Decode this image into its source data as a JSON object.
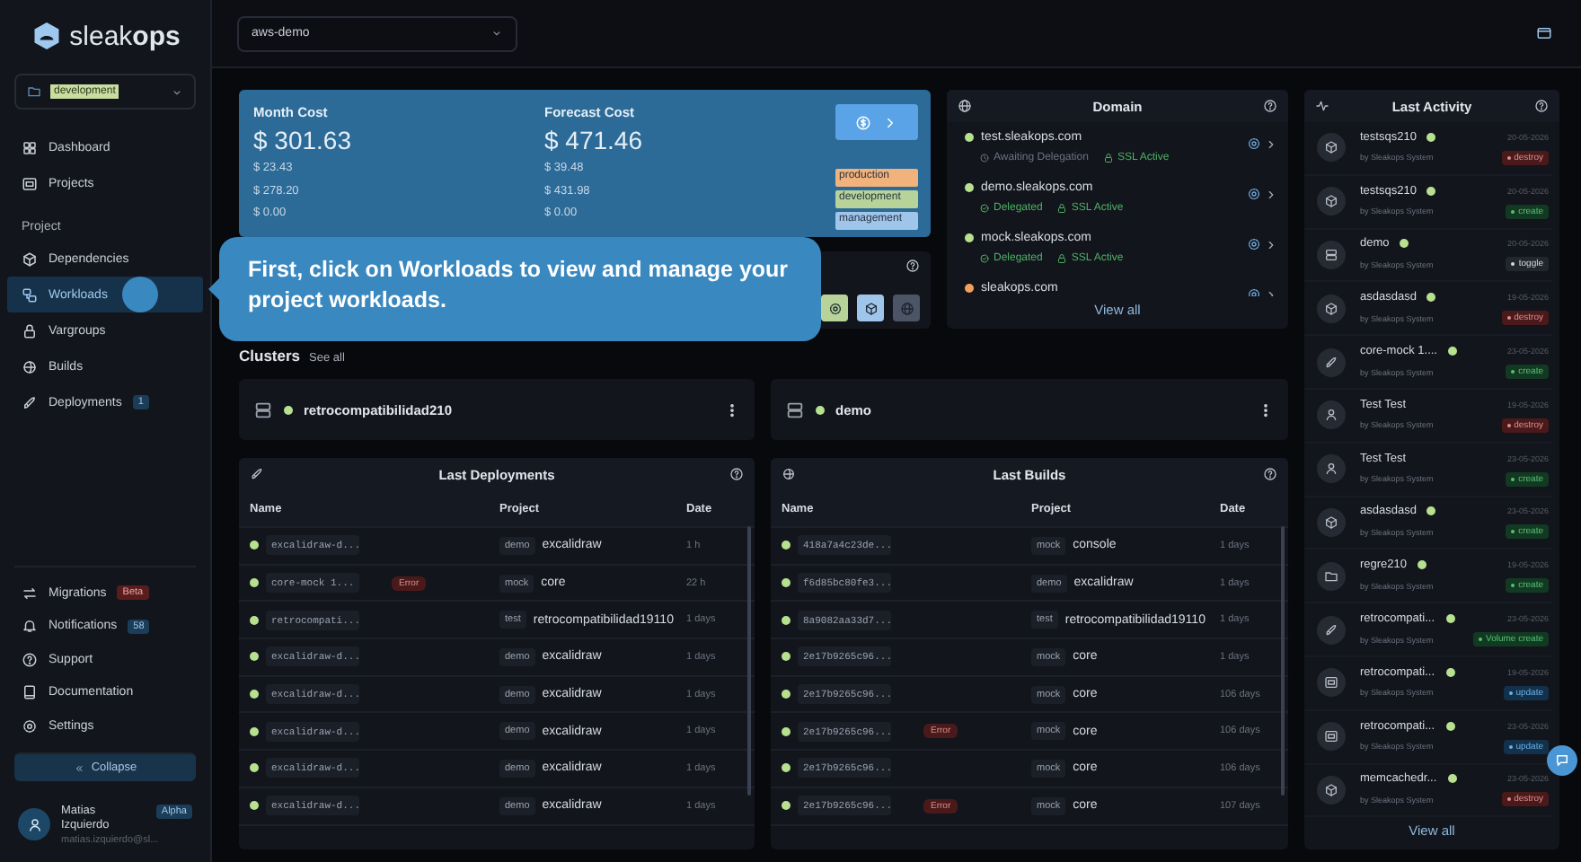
{
  "sidebar": {
    "logo": "sleak**ops**",
    "environment": "development",
    "nav": [
      {
        "label": "Dashboard",
        "selected": false
      },
      {
        "label": "Projects",
        "selected": false
      }
    ],
    "section": "Project",
    "project_nav": [
      {
        "label": "Dependencies",
        "selected": false
      },
      {
        "label": "Workloads",
        "selected": true
      },
      {
        "label": "Vargroups",
        "selected": false
      },
      {
        "label": "Builds",
        "selected": false
      },
      {
        "label": "Deployments",
        "selected": false,
        "badge": {
          "text": "1",
          "kind": "count"
        }
      }
    ],
    "bottom_nav": [
      {
        "label": "Migrations",
        "badge": {
          "text": "Beta",
          "kind": "beta"
        }
      },
      {
        "label": "Notifications",
        "badge": {
          "text": "58",
          "kind": "count"
        }
      },
      {
        "label": "Support"
      },
      {
        "label": "Documentation"
      },
      {
        "label": "Settings"
      }
    ],
    "collapse": "Collapse",
    "user": {
      "name": "Matias Izquierdo",
      "plan": "Alpha",
      "email": "matias.izquierdo@sl..."
    }
  },
  "topbar": {
    "account": "aws-demo"
  },
  "tour": {
    "text": "First, click on Workloads to view and manage your project workloads."
  },
  "costs": {
    "columns": [
      {
        "title": "Month Cost",
        "total": "$ 301.63",
        "lines": [
          "$ 23.43",
          "$ 278.20",
          "$ 0.00"
        ]
      },
      {
        "title": "Forecast Cost",
        "total": "$ 471.46",
        "lines": [
          "$ 39.48",
          "$ 431.98",
          "$ 0.00"
        ]
      }
    ],
    "environments": [
      {
        "label": "production",
        "color": "#f2b27c"
      },
      {
        "label": "development",
        "color": "#b7d39a"
      },
      {
        "label": "management",
        "color": "#9fc6ea"
      }
    ]
  },
  "toolbar_buttons": [
    {
      "color": "#b7d39a"
    },
    {
      "color": "#9fc6ea"
    },
    {
      "color": "#4b5566"
    }
  ],
  "domain": {
    "title": "Domain",
    "items": [
      {
        "name": "test.sleakops.com",
        "color": "#b7e08f",
        "delegation": {
          "text": "Awaiting Delegation",
          "kind": "pending"
        },
        "ssl": "SSL Active"
      },
      {
        "name": "demo.sleakops.com",
        "color": "#b7e08f",
        "delegation": {
          "text": "Delegated",
          "kind": "done"
        },
        "ssl": "SSL Active"
      },
      {
        "name": "mock.sleakops.com",
        "color": "#b7e08f",
        "delegation": {
          "text": "Delegated",
          "kind": "done"
        },
        "ssl": "SSL Active"
      },
      {
        "name": "sleakops.com",
        "color": "#f2a15c"
      }
    ],
    "view_all": "View all"
  },
  "clusters": {
    "title": "Clusters",
    "see_all": "See all",
    "items": [
      {
        "name": "retrocompatibilidad210"
      },
      {
        "name": "demo"
      }
    ]
  },
  "deployments": {
    "title": "Last Deployments",
    "columns": [
      "Name",
      "Project",
      "Date"
    ],
    "rows": [
      {
        "name": "excalidraw-d...",
        "env": "demo",
        "project": "excalidraw",
        "date": "1 h"
      },
      {
        "name": "core-mock 1...",
        "tag": "Error",
        "env": "mock",
        "project": "core",
        "date": "22 h"
      },
      {
        "name": "retrocompati...",
        "env": "test",
        "project": "retrocompatibilidad19110",
        "date": "1 days"
      },
      {
        "name": "excalidraw-d...",
        "env": "demo",
        "project": "excalidraw",
        "date": "1 days"
      },
      {
        "name": "excalidraw-d...",
        "env": "demo",
        "project": "excalidraw",
        "date": "1 days"
      },
      {
        "name": "excalidraw-d...",
        "env": "demo",
        "project": "excalidraw",
        "date": "1 days"
      },
      {
        "name": "excalidraw-d...",
        "env": "demo",
        "project": "excalidraw",
        "date": "1 days"
      },
      {
        "name": "excalidraw-d...",
        "env": "demo",
        "project": "excalidraw",
        "date": "1 days"
      }
    ]
  },
  "builds": {
    "title": "Last Builds",
    "columns": [
      "Name",
      "Project",
      "Date"
    ],
    "rows": [
      {
        "name": "418a7a4c23de...",
        "env": "mock",
        "project": "console",
        "date": "1 days"
      },
      {
        "name": "f6d85bc80fe3...",
        "env": "demo",
        "project": "excalidraw",
        "date": "1 days"
      },
      {
        "name": "8a9082aa33d7...",
        "env": "test",
        "project": "retrocompatibilidad19110",
        "date": "1 days"
      },
      {
        "name": "2e17b9265c96...",
        "env": "mock",
        "project": "core",
        "date": "1 days"
      },
      {
        "name": "2e17b9265c96...",
        "env": "mock",
        "project": "core",
        "date": "106 days"
      },
      {
        "name": "2e17b9265c96...",
        "tag": "Error",
        "env": "mock",
        "project": "core",
        "date": "106 days"
      },
      {
        "name": "2e17b9265c96...",
        "env": "mock",
        "project": "core",
        "date": "106 days"
      },
      {
        "name": "2e17b9265c96...",
        "tag": "Error",
        "env": "mock",
        "project": "core",
        "date": "107 days"
      }
    ]
  },
  "activity": {
    "title": "Last Activity",
    "items": [
      {
        "name": "testsqs210",
        "kind": "dependency",
        "online": true,
        "by": "by Sleakops System",
        "date": "20-05-2026",
        "action": {
          "text": "destroy",
          "kind": "destroy"
        }
      },
      {
        "name": "testsqs210",
        "kind": "dependency",
        "online": true,
        "by": "by Sleakops System",
        "date": "20-05-2026",
        "action": {
          "text": "create",
          "kind": "create"
        }
      },
      {
        "name": "demo",
        "kind": "cluster",
        "online": true,
        "by": "by Sleakops System",
        "date": "20-05-2026",
        "action": {
          "text": "toggle",
          "kind": "toggle"
        }
      },
      {
        "name": "asdasdasd",
        "kind": "dependency",
        "online": true,
        "by": "by Sleakops System",
        "date": "19-05-2026",
        "action": {
          "text": "destroy",
          "kind": "destroy"
        }
      },
      {
        "name": "core-mock 1....",
        "kind": "workload",
        "online": true,
        "by": "by Sleakops System",
        "date": "23-05-2026",
        "action": {
          "text": "create",
          "kind": "create"
        }
      },
      {
        "name": "Test Test",
        "kind": "user",
        "online": false,
        "by": "by Sleakops System",
        "date": "19-05-2026",
        "action": {
          "text": "destroy",
          "kind": "destroy"
        }
      },
      {
        "name": "Test Test",
        "kind": "user",
        "online": false,
        "by": "by Sleakops System",
        "date": "23-05-2026",
        "action": {
          "text": "create",
          "kind": "create"
        }
      },
      {
        "name": "asdasdasd",
        "kind": "dependency",
        "online": true,
        "by": "by Sleakops System",
        "date": "23-05-2026",
        "action": {
          "text": "create",
          "kind": "create"
        }
      },
      {
        "name": "regre210",
        "kind": "project",
        "online": true,
        "by": "by Sleakops System",
        "date": "19-05-2026",
        "action": {
          "text": "create",
          "kind": "create"
        }
      },
      {
        "name": "retrocompati...",
        "kind": "workload",
        "online": true,
        "by": "by Sleakops System",
        "date": "23-05-2026",
        "action": {
          "text": "Volume create",
          "kind": "create"
        }
      },
      {
        "name": "retrocompati...",
        "kind": "vargroup",
        "online": true,
        "by": "by Sleakops System",
        "date": "19-05-2026",
        "action": {
          "text": "update",
          "kind": "update"
        }
      },
      {
        "name": "retrocompati...",
        "kind": "vargroup",
        "online": true,
        "by": "by Sleakops System",
        "date": "23-05-2026",
        "action": {
          "text": "update",
          "kind": "update"
        }
      },
      {
        "name": "memcachedr...",
        "kind": "dependency",
        "online": true,
        "by": "by Sleakops System",
        "date": "23-05-2026",
        "action": {
          "text": "destroy",
          "kind": "destroy"
        }
      }
    ],
    "view_all": "View all"
  }
}
